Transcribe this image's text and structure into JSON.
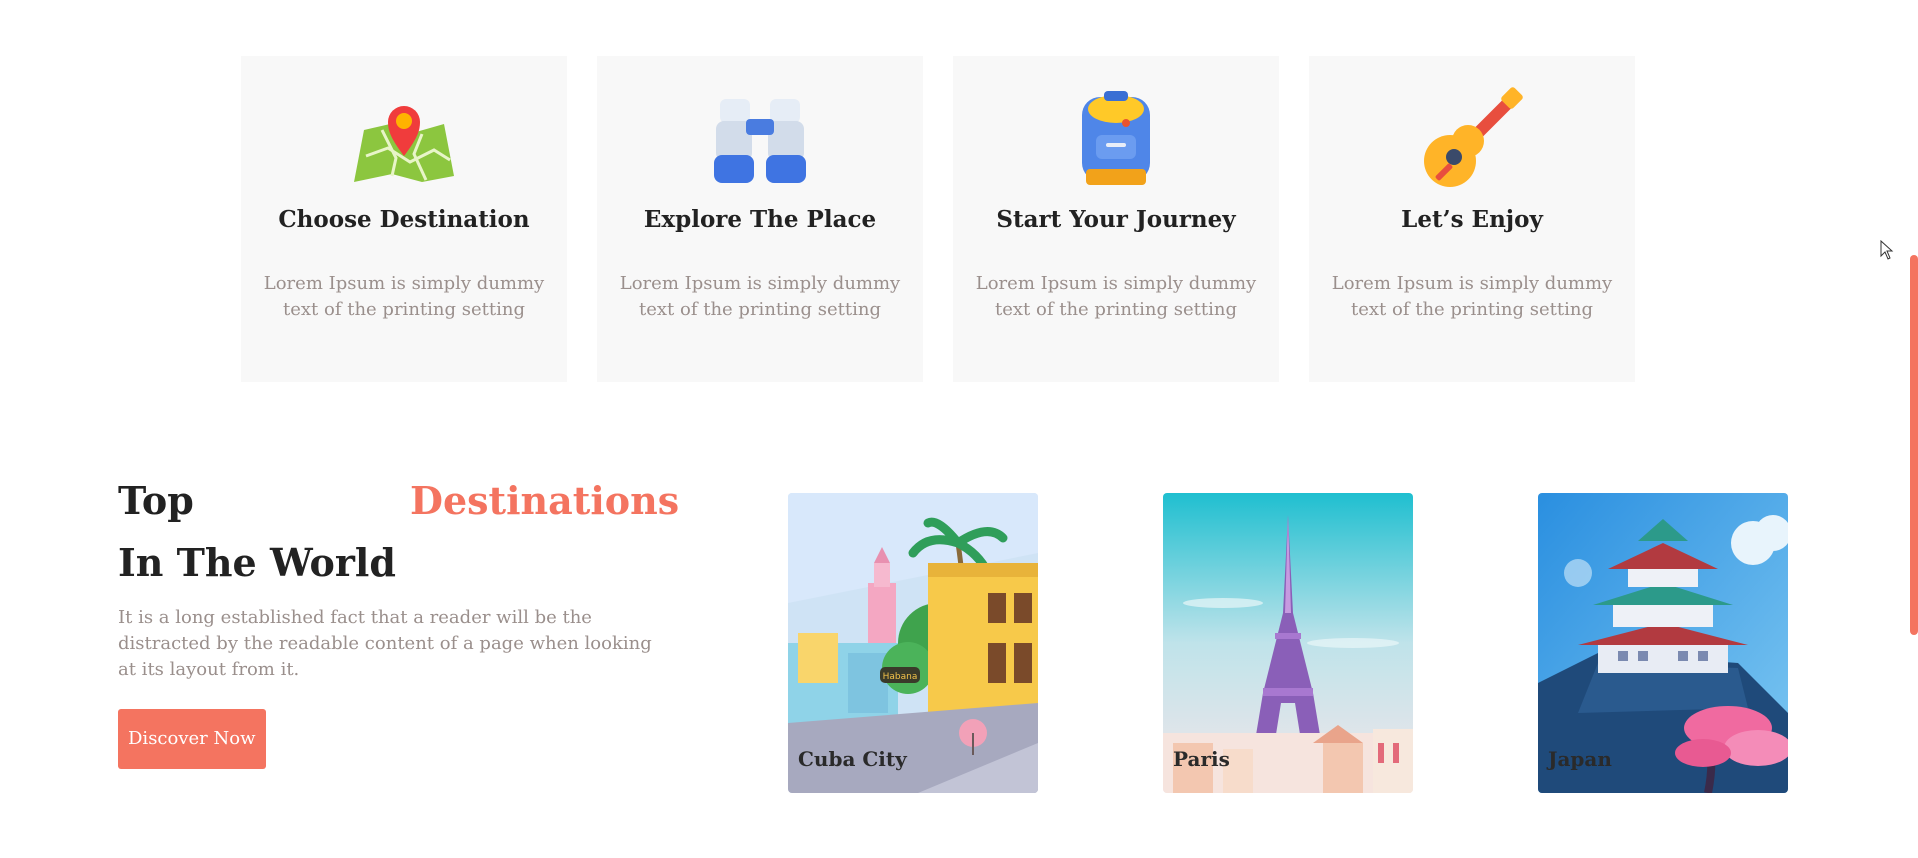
{
  "steps": [
    {
      "title": "Choose Destination",
      "desc": "Lorem Ipsum is simply dummy text of the printing setting",
      "icon": "map-pin-icon"
    },
    {
      "title": "Explore The Place",
      "desc": "Lorem Ipsum is simply dummy text of the printing setting",
      "icon": "binoculars-icon"
    },
    {
      "title": "Start Your Journey",
      "desc": "Lorem Ipsum is simply dummy text of the printing setting",
      "icon": "backpack-icon"
    },
    {
      "title": "Let’s Enjoy",
      "desc": "Lorem Ipsum is simply dummy text of the printing setting",
      "icon": "guitar-icon"
    }
  ],
  "hero": {
    "top": "Top",
    "highlight": "Destinations",
    "line2": "In The World",
    "text": "It is a long established fact that a reader will be the distracted by the readable content of a page when looking at its layout from it.",
    "button": "Discover Now"
  },
  "destinations": [
    {
      "name": "Cuba City",
      "sign": "Habana"
    },
    {
      "name": "Paris"
    },
    {
      "name": "Japan"
    }
  ],
  "colors": {
    "accent": "#f47460",
    "card_bg": "#f8f8f8",
    "muted_text": "#9a8f8c"
  }
}
